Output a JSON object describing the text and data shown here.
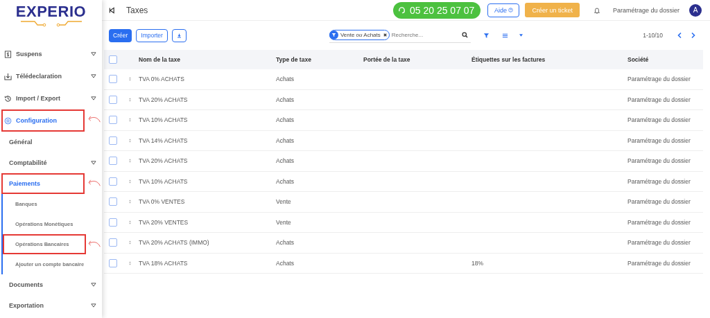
{
  "logo": {
    "text": "EXPERIO"
  },
  "sidebar": {
    "items": [
      {
        "kind": "section",
        "label": "Suspens",
        "expanded": false,
        "selected": false,
        "highlighted": false
      },
      {
        "kind": "section",
        "label": "Télédeclaration",
        "expanded": false,
        "selected": false,
        "highlighted": false
      },
      {
        "kind": "section",
        "label": "Import / Export",
        "expanded": false,
        "selected": false,
        "highlighted": false
      },
      {
        "kind": "section",
        "label": "Configuration",
        "expanded": true,
        "selected": true,
        "highlighted": true,
        "children": [
          {
            "kind": "group",
            "label": "Général",
            "selected": false,
            "highlighted": false
          },
          {
            "kind": "group",
            "label": "Comptabilité",
            "expanded": false,
            "selected": false,
            "highlighted": false
          },
          {
            "kind": "group",
            "label": "Paiements",
            "expanded": true,
            "selected": true,
            "highlighted": true,
            "children": [
              {
                "kind": "link",
                "label": "Banques",
                "selected": false,
                "highlighted": false
              },
              {
                "kind": "link",
                "label": "Opérations Monétiques",
                "selected": false,
                "highlighted": false
              },
              {
                "kind": "link",
                "label": "Opérations Bancaires",
                "selected": false,
                "highlighted": true
              },
              {
                "kind": "link",
                "label": "Ajouter un compte bancaire",
                "selected": false,
                "highlighted": false
              }
            ]
          }
        ]
      },
      {
        "kind": "plain",
        "label": "Documents",
        "expanded": false,
        "selected": false,
        "highlighted": false
      },
      {
        "kind": "plain",
        "label": "Exportation",
        "expanded": false,
        "selected": false,
        "highlighted": false
      }
    ]
  },
  "topbar": {
    "title": "Taxes",
    "phone": "05 20 25 07 07",
    "help": "Aide",
    "ticket": "Créer un ticket",
    "company": "Paramétrage du dossier",
    "avatar": "A"
  },
  "toolbar": {
    "create": "Créer",
    "import": "Importer",
    "facet": "Vente *ou* Achats",
    "placeholder": "Recherche...",
    "pager": "1-10/10"
  },
  "table": {
    "all_selected": false,
    "columns": [
      "Nom de la taxe",
      "Type de taxe",
      "Portée de la taxe",
      "Étiquettes sur les factures",
      "Société"
    ],
    "rows": [
      {
        "name": "TVA 0% ACHATS",
        "type": "Achats",
        "company": "Paramétrage du dossier",
        "selected": false
      },
      {
        "name": "TVA 20% ACHATS",
        "type": "Achats",
        "company": "Paramétrage du dossier",
        "selected": false
      },
      {
        "name": "TVA 10% ACHATS",
        "type": "Achats",
        "company": "Paramétrage du dossier",
        "selected": false
      },
      {
        "name": "TVA 14% ACHATS",
        "type": "Achats",
        "company": "Paramétrage du dossier",
        "selected": false
      },
      {
        "name": "TVA 20% ACHATS",
        "type": "Achats",
        "company": "Paramétrage du dossier",
        "selected": false
      },
      {
        "name": "TVA 10% ACHATS",
        "type": "Achats",
        "company": "Paramétrage du dossier",
        "selected": false
      },
      {
        "name": "TVA 0% VENTES",
        "type": "Vente",
        "company": "Paramétrage du dossier",
        "selected": false
      },
      {
        "name": "TVA 20% VENTES",
        "type": "Vente",
        "company": "Paramétrage du dossier",
        "selected": false
      },
      {
        "name": "TVA 20% ACHATS (IMMO)",
        "type": "Achats",
        "company": "Paramétrage du dossier",
        "selected": false
      },
      {
        "name": "TVA 18% ACHATS",
        "type": "Achats",
        "labels": "18%",
        "company": "Paramétrage du dossier",
        "selected": false
      }
    ]
  }
}
